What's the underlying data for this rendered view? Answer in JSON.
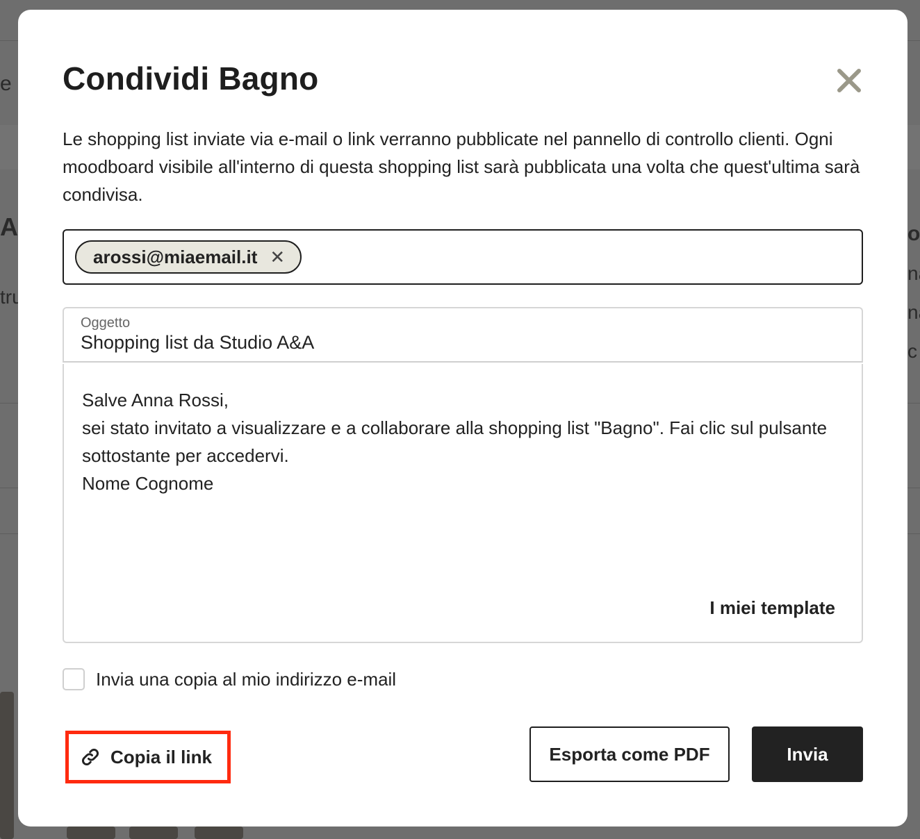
{
  "background": {
    "fragments": [
      "e",
      "A",
      "tru",
      "o",
      "na",
      "na",
      "c"
    ]
  },
  "modal": {
    "title": "Condividi Bagno",
    "description": "Le shopping list inviate via e-mail o link verranno pubblicate nel pannello di controllo clienti. Ogni moodboard visibile all'interno di questa shopping list sarà pubblicata una volta che quest'ultima sarà condivisa.",
    "recipients": {
      "chips": [
        {
          "email": "arossi@miaemail.it",
          "remove_label": "✕"
        }
      ]
    },
    "subject": {
      "label": "Oggetto",
      "value": "Shopping list da Studio A&A"
    },
    "message": {
      "lines": [
        "Salve Anna Rossi,",
        "sei stato invitato a visualizzare e a collaborare alla shopping list \"Bagno\". Fai clic sul pulsante sottostante per accedervi.",
        "Nome Cognome"
      ],
      "templates_link": "I miei template"
    },
    "send_copy": {
      "label": "Invia una copia al mio indirizzo e-mail",
      "checked": false
    },
    "actions": {
      "copy_link": "Copia il link",
      "export_pdf": "Esporta come PDF",
      "send": "Invia"
    },
    "colors": {
      "highlight": "#ff2a0f",
      "primary_button": "#222222",
      "chip_bg": "#e8e7de",
      "close_icon": "#9a9889"
    }
  }
}
